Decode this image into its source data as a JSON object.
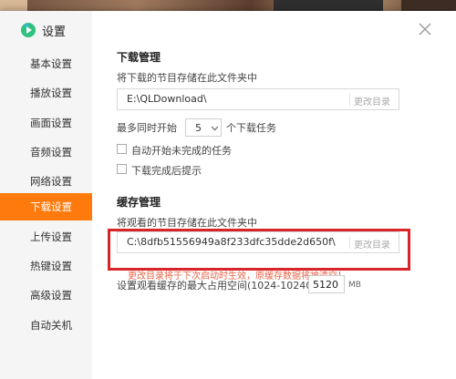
{
  "window": {
    "title": "设置",
    "close_icon": "close-icon"
  },
  "sidebar": {
    "items": [
      {
        "label": "基本设置",
        "active": false
      },
      {
        "label": "播放设置",
        "active": false
      },
      {
        "label": "画面设置",
        "active": false
      },
      {
        "label": "音频设置",
        "active": false
      },
      {
        "label": "网络设置",
        "active": false
      },
      {
        "label": "下载设置",
        "active": true
      },
      {
        "label": "上传设置",
        "active": false
      },
      {
        "label": "热键设置",
        "active": false
      },
      {
        "label": "高级设置",
        "active": false
      },
      {
        "label": "自动关机",
        "active": false
      }
    ]
  },
  "download": {
    "title": "下载管理",
    "desc": "将下载的节目存储在此文件夹中",
    "path": "E:\\QLDownload\\",
    "change_dir": "更改目录",
    "max_prefix": "最多同时开始",
    "max_value": "5",
    "max_suffix": "个下载任务",
    "auto_start_label": "自动开始未完成的任务",
    "notify_label": "下载完成后提示"
  },
  "cache": {
    "title": "缓存管理",
    "desc": "将观看的节目存储在此文件夹中",
    "path": "C:\\8dfb51556949a8f233dfc35dde2d650f\\",
    "change_dir": "更改目录",
    "note": "更改目录将于下次启动时生效，原缓存数据将被清空！",
    "max_label": "设置观看缓存的最大占用空间(1024-10240)",
    "max_value": "5120",
    "unit": "MB"
  },
  "colors": {
    "accent": "#ff7a0d",
    "highlight": "#d9252a"
  }
}
